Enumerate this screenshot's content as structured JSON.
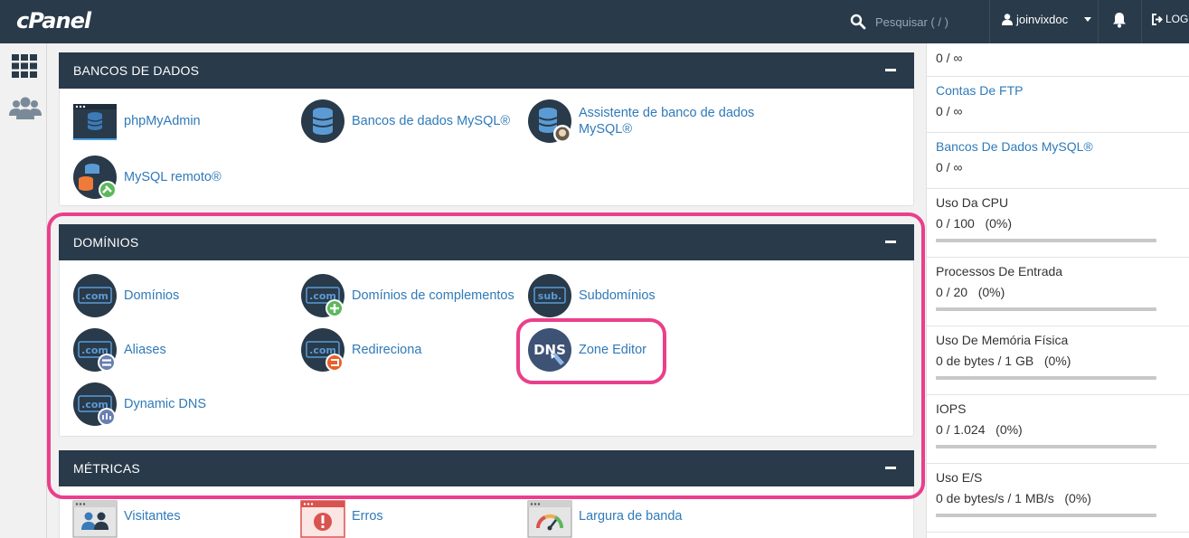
{
  "topbar": {
    "logo": "cPanel",
    "search_placeholder": "Pesquisar ( / )",
    "username": "joinvixdoc",
    "logout_label": "LOG"
  },
  "sections": [
    {
      "title": "BANCOS DE DADOS",
      "items": [
        {
          "label": "phpMyAdmin",
          "icon": "phpmyadmin-icon"
        },
        {
          "label": "Bancos de dados MySQL®",
          "icon": "mysql-databases-icon"
        },
        {
          "label": "Assistente de banco de dados MySQL®",
          "icon": "mysql-wizard-icon"
        },
        {
          "label": "MySQL remoto®",
          "icon": "remote-mysql-icon"
        }
      ]
    },
    {
      "title": "DOMÍNIOS",
      "items": [
        {
          "label": "Domínios",
          "icon": "domains-icon"
        },
        {
          "label": "Domínios de complementos",
          "icon": "addon-domains-icon"
        },
        {
          "label": "Subdomínios",
          "icon": "subdomains-icon"
        },
        {
          "label": "Aliases",
          "icon": "aliases-icon"
        },
        {
          "label": "Redireciona",
          "icon": "redirects-icon"
        },
        {
          "label": "Zone Editor",
          "icon": "dns-zone-editor-icon"
        },
        {
          "label": "Dynamic DNS",
          "icon": "dynamic-dns-icon"
        }
      ]
    },
    {
      "title": "MÉTRICAS",
      "items": [
        {
          "label": "Visitantes",
          "icon": "visitors-icon"
        },
        {
          "label": "Erros",
          "icon": "errors-icon"
        },
        {
          "label": "Largura de banda",
          "icon": "bandwidth-icon"
        }
      ]
    }
  ],
  "stats": [
    {
      "label": "",
      "value": "0 / ∞"
    },
    {
      "label": "Contas De FTP",
      "value": "0 / ∞"
    },
    {
      "label": "Bancos De Dados MySQL®",
      "value": "0 / ∞"
    },
    {
      "label": "Uso Da CPU",
      "value": "0 / 100   (0%)",
      "usage": 0
    },
    {
      "label": "Processos De Entrada",
      "value": "0 / 20   (0%)",
      "usage": 0
    },
    {
      "label": "Uso De Memória Física",
      "value": "0 de bytes / 1 GB   (0%)",
      "usage": 0
    },
    {
      "label": "IOPS",
      "value": "0 / 1.024   (0%)",
      "usage": 0
    },
    {
      "label": "Uso E/S",
      "value": "0 de bytes/s / 1 MB/s   (0%)",
      "usage": 0
    }
  ],
  "colors": {
    "header_bg": "#293a4a",
    "link": "#2f7ab9",
    "highlight": "#ea3f8b"
  }
}
